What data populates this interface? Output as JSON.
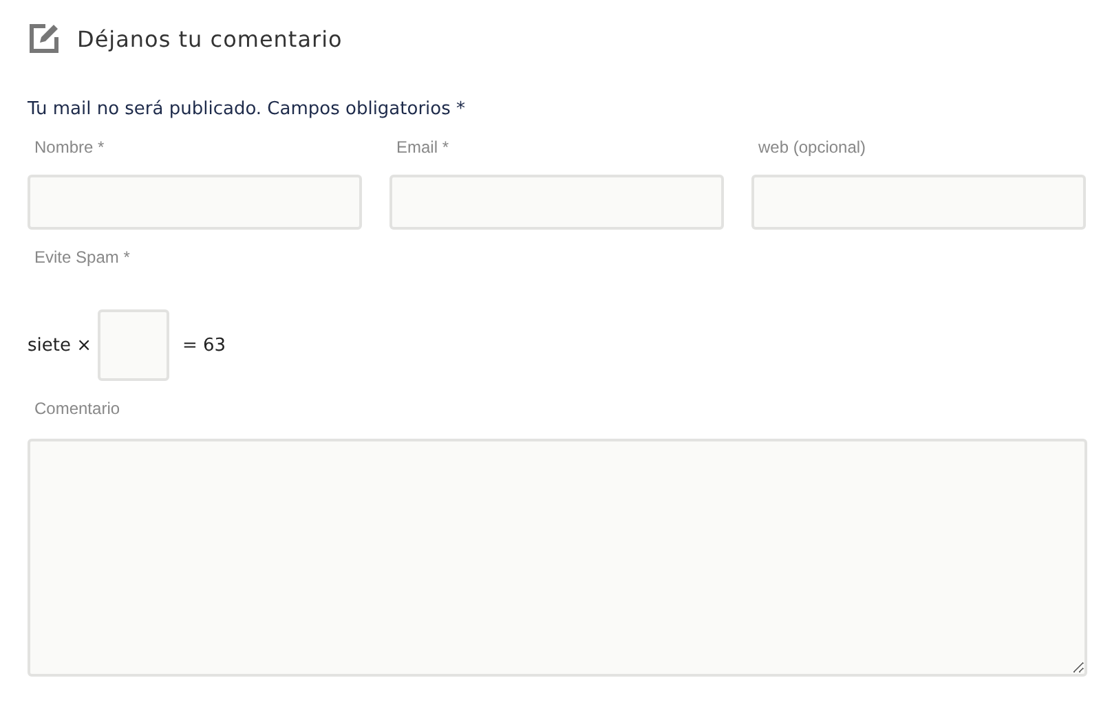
{
  "heading": "Déjanos tu comentario",
  "notice": "Tu mail no será publicado. Campos obligatorios *",
  "fields": [
    {
      "label": "Nombre *"
    },
    {
      "label": "Email *"
    },
    {
      "label": "web (opcional)"
    }
  ],
  "captcha": {
    "label": "Evite Spam *",
    "before": "siete ×",
    "after": "= 63"
  },
  "comment": {
    "label": "Comentario"
  }
}
